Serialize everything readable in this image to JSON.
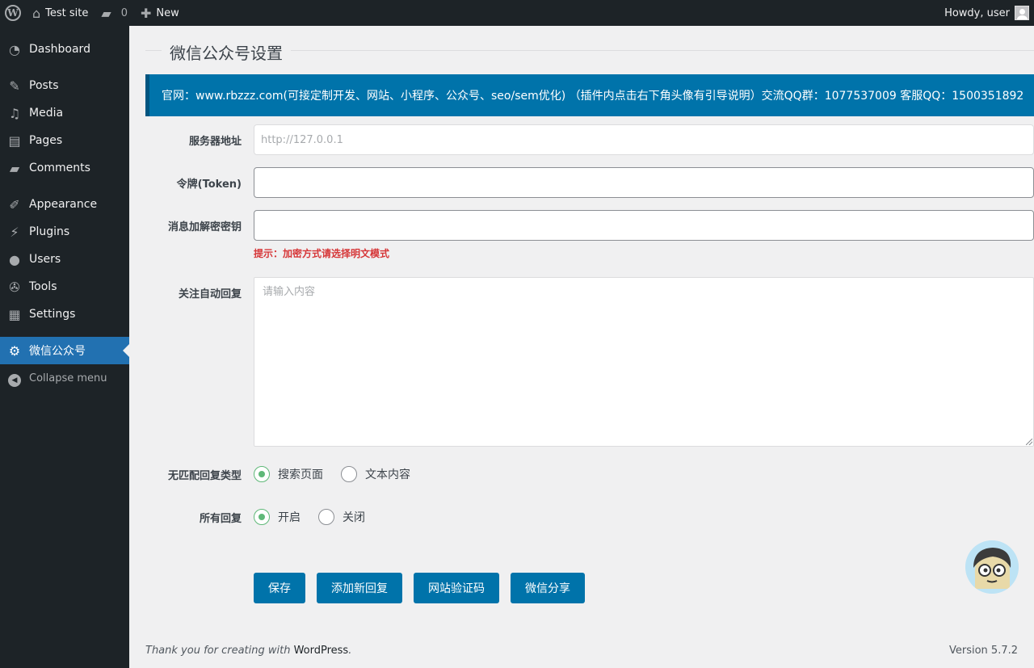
{
  "adminbar": {
    "site_name": "Test site",
    "comments_count": "0",
    "new_label": "New",
    "greeting": "Howdy, user"
  },
  "sidebar": {
    "items": [
      {
        "label": "Dashboard",
        "icon": "dashboard-icon"
      },
      {
        "label": "Posts",
        "icon": "pin-icon"
      },
      {
        "label": "Media",
        "icon": "media-icon"
      },
      {
        "label": "Pages",
        "icon": "pages-icon"
      },
      {
        "label": "Comments",
        "icon": "comment-icon"
      },
      {
        "label": "Appearance",
        "icon": "brush-icon"
      },
      {
        "label": "Plugins",
        "icon": "plug-icon"
      },
      {
        "label": "Users",
        "icon": "user-icon"
      },
      {
        "label": "Tools",
        "icon": "wrench-icon"
      },
      {
        "label": "Settings",
        "icon": "sliders-icon"
      },
      {
        "label": "微信公众号",
        "icon": "gear-icon"
      }
    ],
    "collapse_label": "Collapse menu"
  },
  "page": {
    "title": "微信公众号设置",
    "notice": "官网：www.rbzzz.com(可接定制开发、网站、小程序、公众号、seo/sem优化) （插件内点击右下角头像有引导说明）交流QQ群：1077537009 客服QQ：1500351892"
  },
  "form": {
    "server_label": "服务器地址",
    "server_value": "http://127.0.0.1",
    "token_label": "令牌(Token)",
    "token_value": "",
    "aes_label": "消息加解密密钥",
    "aes_value": "",
    "hint": "提示：加密方式请选择明文模式",
    "auto_reply_label": "关注自动回复",
    "auto_reply_placeholder": "请输入内容",
    "nomatch_label": "无匹配回复类型",
    "nomatch_options": [
      "搜索页面",
      "文本内容"
    ],
    "nomatch_selected": 0,
    "all_reply_label": "所有回复",
    "all_reply_options": [
      "开启",
      "关闭"
    ],
    "all_reply_selected": 0
  },
  "buttons": {
    "save": "保存",
    "add_reply": "添加新回复",
    "verify": "网站验证码",
    "share": "微信分享"
  },
  "footer": {
    "thanks": "Thank you for creating with ",
    "wp_link": "WordPress",
    "period": ".",
    "version": "Version 5.7.2"
  },
  "colors": {
    "accent": "#0073aa",
    "radio_checked": "#5fb878",
    "hint_red": "#d63638",
    "menu_current": "#2271b1"
  }
}
